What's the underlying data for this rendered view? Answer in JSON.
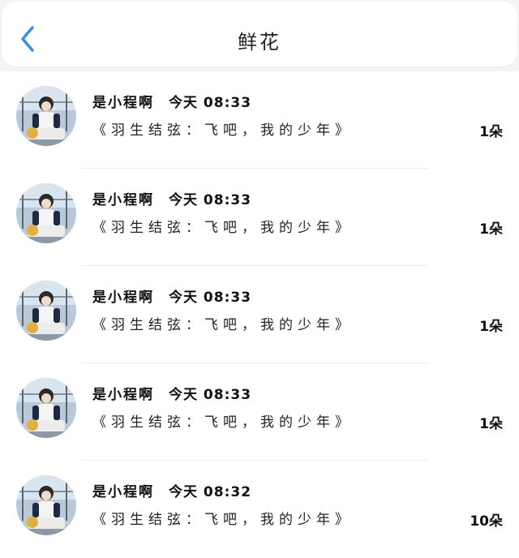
{
  "header": {
    "title": "鲜花",
    "back_icon": "chevron-left-icon",
    "back_color": "#3a8ee6"
  },
  "items": [
    {
      "name": "是小程啊",
      "time": "今天 08:33",
      "desc": "《羽生结弦：飞吧，我的少年》",
      "count": "1朵"
    },
    {
      "name": "是小程啊",
      "time": "今天 08:33",
      "desc": "《羽生结弦：飞吧，我的少年》",
      "count": "1朵"
    },
    {
      "name": "是小程啊",
      "time": "今天 08:33",
      "desc": "《羽生结弦：飞吧，我的少年》",
      "count": "1朵"
    },
    {
      "name": "是小程啊",
      "time": "今天 08:33",
      "desc": "《羽生结弦：飞吧，我的少年》",
      "count": "1朵"
    },
    {
      "name": "是小程啊",
      "time": "今天 08:32",
      "desc": "《羽生结弦：飞吧，我的少年》",
      "count": "10朵"
    }
  ]
}
